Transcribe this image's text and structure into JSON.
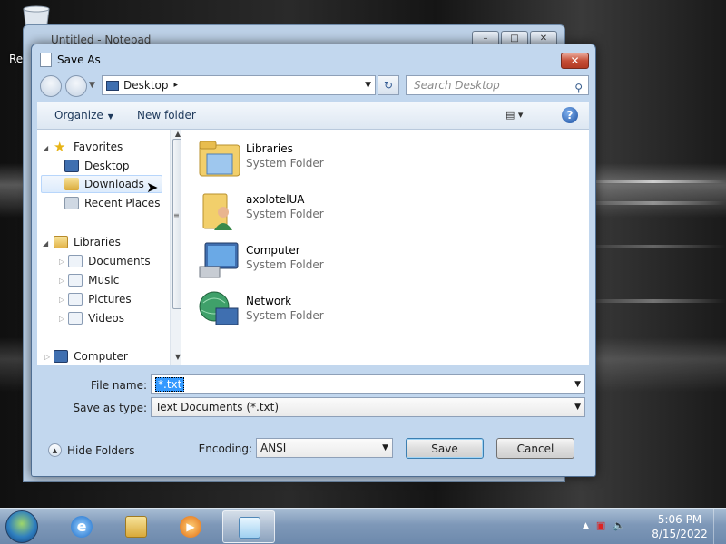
{
  "desktop": {
    "recycle_label": "Rec"
  },
  "notepad": {
    "title": "Untitled - Notepad",
    "min": "–",
    "max": "□",
    "close": "✕"
  },
  "dialog": {
    "title": "Save As",
    "close": "✕",
    "address": {
      "location": "Desktop",
      "sep": "▸",
      "dd": "▼"
    },
    "refresh": "↻",
    "search_placeholder": "Search Desktop",
    "search_icon": "search-icon",
    "toolbar": {
      "organize": "Organize",
      "new_folder": "New folder",
      "views": "▤ ▾",
      "help": "?"
    },
    "nav": {
      "favorites": "Favorites",
      "desktop": "Desktop",
      "downloads": "Downloads",
      "recent": "Recent Places",
      "libraries": "Libraries",
      "documents": "Documents",
      "music": "Music",
      "pictures": "Pictures",
      "videos": "Videos",
      "computer": "Computer"
    },
    "items": [
      {
        "name": "Libraries",
        "type": "System Folder",
        "icon": "libraries-icon"
      },
      {
        "name": "axolotelUA",
        "type": "System Folder",
        "icon": "user-folder-icon"
      },
      {
        "name": "Computer",
        "type": "System Folder",
        "icon": "computer-icon"
      },
      {
        "name": "Network",
        "type": "System Folder",
        "icon": "network-icon"
      }
    ],
    "file_name_label": "File name:",
    "file_name_value": "*.txt",
    "save_type_label": "Save as type:",
    "save_type_value": "Text Documents (*.txt)",
    "hide_folders": "Hide Folders",
    "encoding_label": "Encoding:",
    "encoding_value": "ANSI",
    "save": "Save",
    "cancel": "Cancel"
  },
  "taskbar": {
    "time": "5:06 PM",
    "date": "8/15/2022"
  },
  "colors": {
    "accent": "#3399ff",
    "taskbar": "#7e98b8",
    "close": "#c64e36"
  }
}
